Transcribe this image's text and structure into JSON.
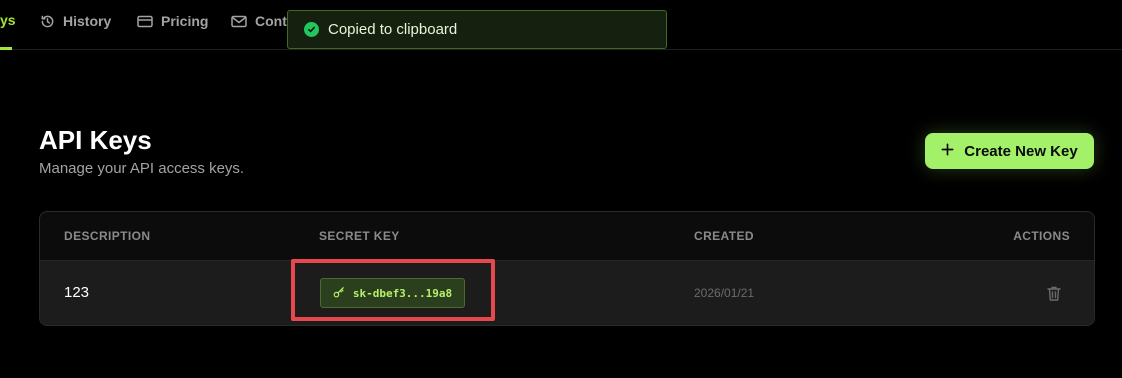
{
  "nav": {
    "active_partial": "ys",
    "items": [
      {
        "label": "History",
        "icon": "history-icon"
      },
      {
        "label": "Pricing",
        "icon": "credit-card-icon"
      },
      {
        "label": "Conta",
        "icon": "mail-icon"
      }
    ]
  },
  "toast": {
    "message": "Copied to clipboard",
    "icon": "check-circle-icon"
  },
  "header": {
    "title": "API Keys",
    "subtitle": "Manage your API access keys.",
    "create_button": "Create New Key"
  },
  "table": {
    "columns": [
      "DESCRIPTION",
      "SECRET KEY",
      "CREATED",
      "ACTIONS"
    ],
    "rows": [
      {
        "description": "123",
        "secret_key": "sk-dbef3...19a8",
        "created": "2026/01/21",
        "action_icon": "trash-icon"
      }
    ]
  },
  "colors": {
    "accent": "#a3e635",
    "button_bg": "#a3f069",
    "highlight": "#e5484d",
    "toast_check": "#22c55e"
  }
}
